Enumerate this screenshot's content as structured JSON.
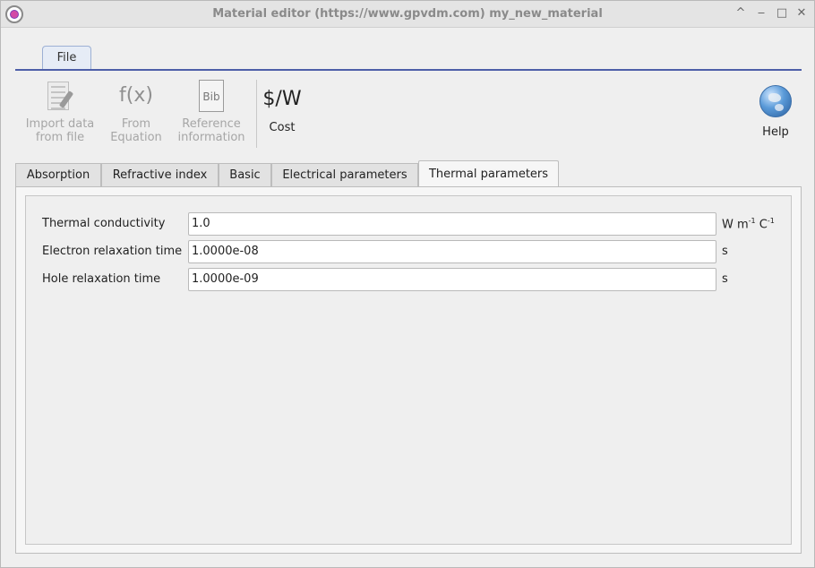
{
  "window": {
    "title": "Material editor (https://www.gpvdm.com) my_new_material",
    "controls": {
      "up": "^",
      "minimize": "‒",
      "maximize": "□",
      "close": "✕"
    }
  },
  "menu": {
    "file_label": "File"
  },
  "toolbar": {
    "import": {
      "line1": "Import data",
      "line2": "from file",
      "icon": "import-data-icon"
    },
    "equation": {
      "glyph": "f(x)",
      "line1": "From",
      "line2": "Equation"
    },
    "reference": {
      "glyph": "Bib",
      "line1": "Reference",
      "line2": "information"
    },
    "cost": {
      "glyph": "$/W",
      "label": "Cost"
    },
    "help": {
      "label": "Help",
      "icon": "globe-icon"
    }
  },
  "tabs": [
    {
      "label": "Absorption",
      "active": false
    },
    {
      "label": "Refractive index",
      "active": false
    },
    {
      "label": "Basic",
      "active": false
    },
    {
      "label": "Electrical parameters",
      "active": false
    },
    {
      "label": "Thermal parameters",
      "active": true
    }
  ],
  "thermal": {
    "rows": [
      {
        "label": "Thermal conductivity",
        "value": "1.0",
        "unit_w": "W m",
        "unit_exp1": "-1",
        "unit_c": " C",
        "unit_exp2": "-1"
      },
      {
        "label": "Electron relaxation time",
        "value": "1.0000e-08",
        "unit": "s"
      },
      {
        "label": "Hole relaxation time",
        "value": "1.0000e-09",
        "unit": "s"
      }
    ]
  },
  "colors": {
    "menu_line": "#4d5fa8",
    "accent": "#9db0d4"
  }
}
